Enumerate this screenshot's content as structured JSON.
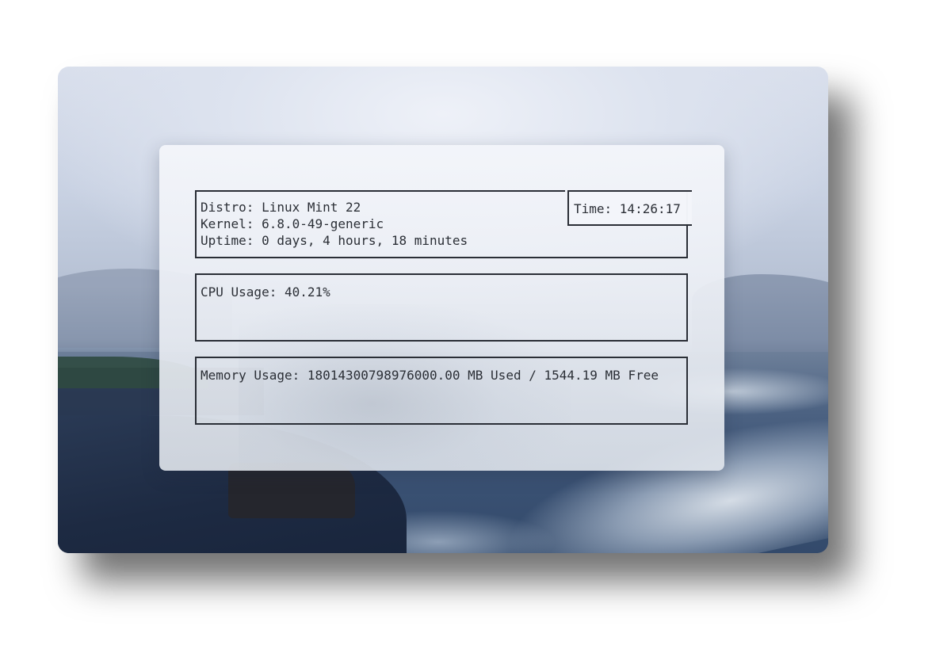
{
  "system_info": {
    "distro_line": "Distro: Linux Mint 22",
    "kernel_line": "Kernel: 6.8.0-49-generic",
    "uptime_line": "Uptime: 0 days, 4 hours, 18 minutes"
  },
  "clock": {
    "time_line": "Time: 14:26:17"
  },
  "cpu": {
    "usage_line": "CPU Usage: 40.21%"
  },
  "memory": {
    "usage_line": "Memory Usage: 18014300798976000.00 MB Used / 1544.19 MB Free"
  }
}
